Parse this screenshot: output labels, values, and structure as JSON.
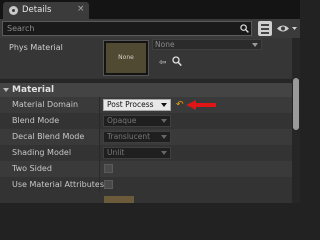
{
  "tab": {
    "title": "Details",
    "close": "×"
  },
  "search": {
    "placeholder": "Search"
  },
  "phys_material": {
    "label": "Phys Material",
    "thumb_text": "None",
    "value": "None"
  },
  "category": {
    "label": "Material"
  },
  "rows": [
    {
      "label": "Material Domain",
      "value": "Post Process",
      "active": true
    },
    {
      "label": "Blend Mode",
      "value": "Opaque"
    },
    {
      "label": "Decal Blend Mode",
      "value": "Translucent"
    },
    {
      "label": "Shading Model",
      "value": "Unlit"
    },
    {
      "label": "Two Sided"
    },
    {
      "label": "Use Material Attributes"
    }
  ],
  "reset_icon": "reset-arrow-icon",
  "colors": {
    "highlight_arrow": "#e01515",
    "reset": "#e0a21b"
  }
}
